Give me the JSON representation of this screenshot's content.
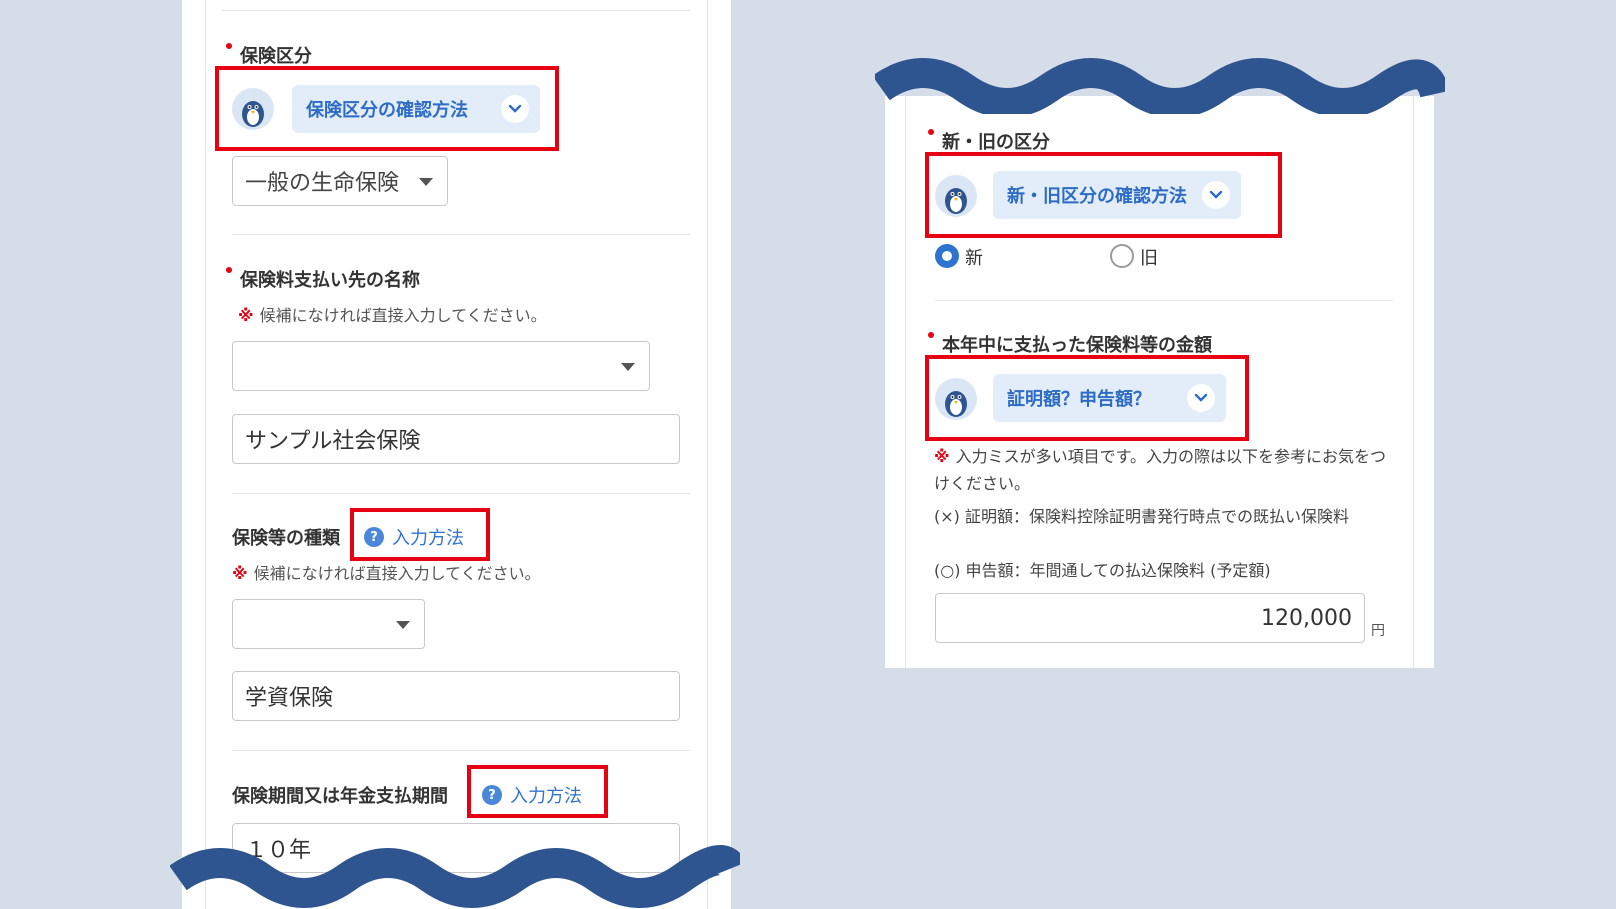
{
  "left_panel": {
    "insurance_category": {
      "label": "保険区分",
      "guide_label": "保険区分の確認方法",
      "select_value": "一般の生命保険"
    },
    "payee_name": {
      "label": "保険料支払い先の名称",
      "note_mark": "※",
      "note": "候補になければ直接入力してください。",
      "select_value": "",
      "input_value": "サンプル社会保険"
    },
    "insurance_type": {
      "label": "保険等の種類",
      "help_label": "入力方法",
      "note_mark": "※",
      "note": "候補になければ直接入力してください。",
      "select_value": "",
      "input_value": "学資保険"
    },
    "insurance_period": {
      "label": "保険期間又は年金支払期間",
      "help_label": "入力方法",
      "input_value": "１０年"
    }
  },
  "right_panel": {
    "new_old": {
      "label": "新・旧の区分",
      "guide_label": "新・旧区分の確認方法",
      "options": [
        "新",
        "旧"
      ],
      "selected": "新"
    },
    "amount": {
      "label": "本年中に支払った保険料等の金額",
      "guide_label": "証明額？申告額？",
      "note_mark": "※",
      "note": "入力ミスが多い項目です。入力の際は以下を参考にお気をつけください。",
      "line1": "(×) 証明額：保険料控除証明書発行時点での既払い保険料",
      "line2": "(○) 申告額：年間通しての払込保険料 (予定額)",
      "value": "120,000",
      "unit": "円"
    }
  },
  "colors": {
    "highlight": "#e60012",
    "wave": "#2f5590",
    "accent": "#2f73d1",
    "background": "#d5dde8"
  },
  "icons": [
    "mascot-icon",
    "chevron-down-icon",
    "help-circle-icon",
    "caret-down-icon"
  ]
}
